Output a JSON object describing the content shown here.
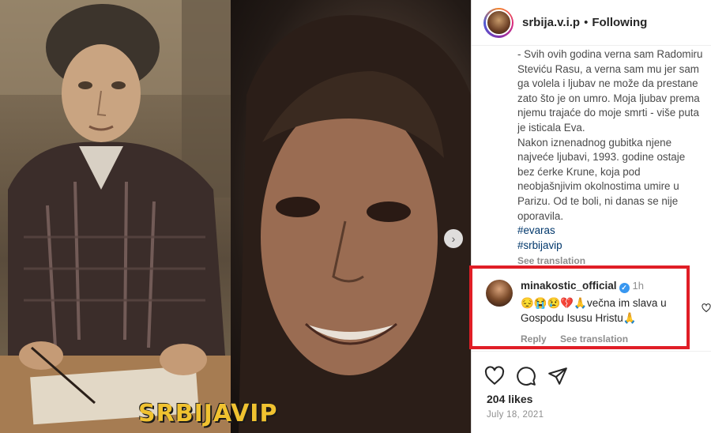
{
  "photo": {
    "watermark": "SRBIJAVIP"
  },
  "header": {
    "username": "srbija.v.i.p",
    "separator": "•",
    "following_label": "Following"
  },
  "caption": {
    "text": "- Svih ovih godina verna sam Radomiru\nSteviću Rasu, a verna sam mu jer sam\nga volela i ljubav ne može da prestane\nzato što je on umro. Moja ljubav prema\nnjemu trajaće do moje smrti - više puta\nje isticala Eva.\nNakon iznenadnog gubitka njene\nnajveće ljubavi, 1993. godine ostaje\nbez ćerke Krune, koja pod\nneobjašnjivim okolnostima umire u\nParizu. Od te boli, ni danas se nije\noporavila.",
    "hashtags": [
      "#evaras",
      "#srbijavip"
    ],
    "see_translation": "See translation"
  },
  "comment": {
    "username": "minakostic_official",
    "verified_glyph": "✓",
    "time": "1h",
    "text": "😔😭😢💔🙏večna im slava u Gospodu Isusu Hristu🙏",
    "reply_label": "Reply",
    "see_translation": "See translation"
  },
  "actions": {
    "likes": "204 likes",
    "date": "July 18, 2021"
  },
  "colors": {
    "highlight_border": "#e01e26",
    "verified": "#3897f0",
    "hashtag": "#00376b",
    "watermark": "#f0c230"
  }
}
